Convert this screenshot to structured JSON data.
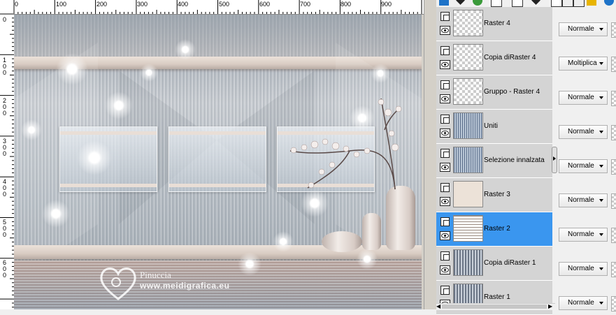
{
  "ruler": {
    "horizontal": [
      "0",
      "100",
      "200",
      "300",
      "400",
      "500",
      "600",
      "700",
      "800",
      "900"
    ],
    "vertical": [
      "0",
      "100",
      "200",
      "300",
      "400",
      "500",
      "600"
    ]
  },
  "watermark": {
    "name": "Pinuccia",
    "url": "www.meidigrafica.eu"
  },
  "layers": [
    {
      "name": "Raster 4",
      "blend": "Normale",
      "thumb": "checker",
      "selected": false
    },
    {
      "name": "Copia diRaster 4",
      "blend": "Moltiplica",
      "thumb": "checker",
      "selected": false
    },
    {
      "name": "Gruppo - Raster 4",
      "blend": "Normale",
      "thumb": "checker",
      "selected": false
    },
    {
      "name": "Uniti",
      "blend": "Normale",
      "thumb": "pattern",
      "selected": false
    },
    {
      "name": "Selezione innalzata",
      "blend": "Normale",
      "thumb": "pattern",
      "selected": false
    },
    {
      "name": "Raster 3",
      "blend": "Normale",
      "thumb": "beige",
      "selected": false
    },
    {
      "name": "Raster 2",
      "blend": "Normale",
      "thumb": "lines",
      "selected": true
    },
    {
      "name": "Copia diRaster 1",
      "blend": "Normale",
      "thumb": "pattern2",
      "selected": false
    },
    {
      "name": "Raster 1",
      "blend": "Normale",
      "thumb": "pattern2",
      "selected": false
    }
  ],
  "colors": {
    "selected_row": "#3a96ef",
    "row_bg": "#d4d4d4"
  }
}
